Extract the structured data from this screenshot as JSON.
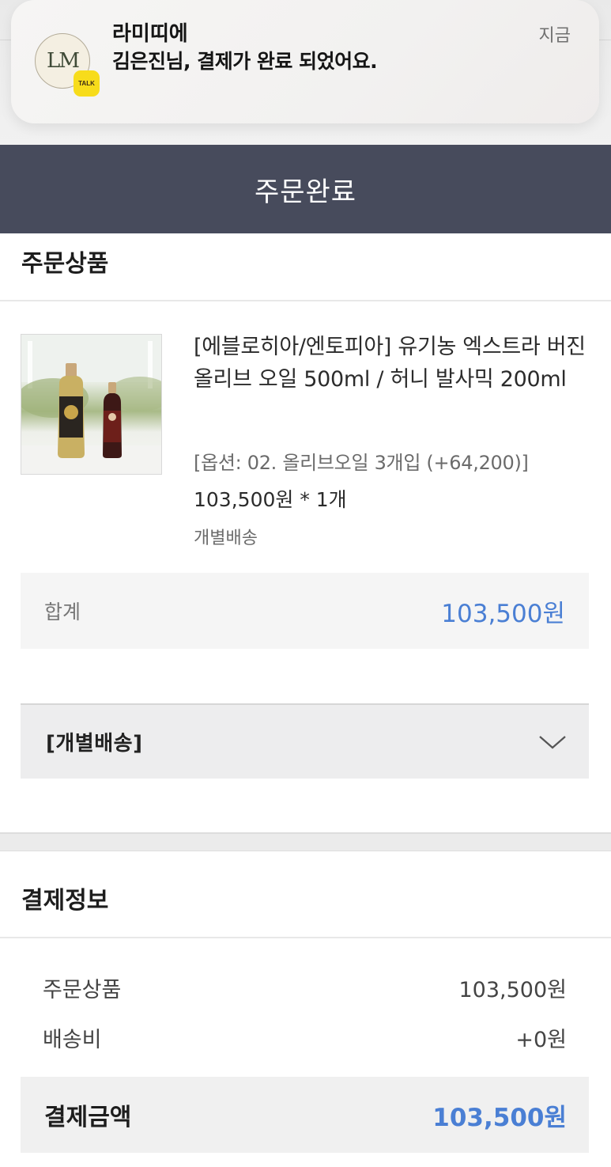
{
  "notification": {
    "app_name": "라미띠에",
    "message": "김은진님, 결제가 완료 되었어요.",
    "time": "지금",
    "logo_text": "LM",
    "badge_text": "TALK"
  },
  "header": {
    "title": "주문완료"
  },
  "order_items": {
    "section_title": "주문상품",
    "product": {
      "name": "[에블로히아/엔토피아] 유기농 엑스트라 버진 올리브 오일 500ml / 허니 발사믹 200ml",
      "option": "[옵션: 02. 올리브오일 3개입 (+64,200)]",
      "price_qty": "103,500원 * 1개",
      "shipping_type": "개별배송"
    },
    "sum_label": "합계",
    "sum_value": "103,500원"
  },
  "accordion": {
    "label": "[개별배송]",
    "icon": "chevron-down-icon"
  },
  "payment": {
    "section_title": "결제정보",
    "rows": [
      {
        "label": "주문상품",
        "value": "103,500원"
      },
      {
        "label": "배송비",
        "value": "+0원"
      }
    ],
    "total_label": "결제금액",
    "total_value": "103,500원"
  },
  "colors": {
    "header_bg": "#474b5c",
    "accent": "#4a7fd4",
    "talk_badge": "#f7dc1b"
  }
}
